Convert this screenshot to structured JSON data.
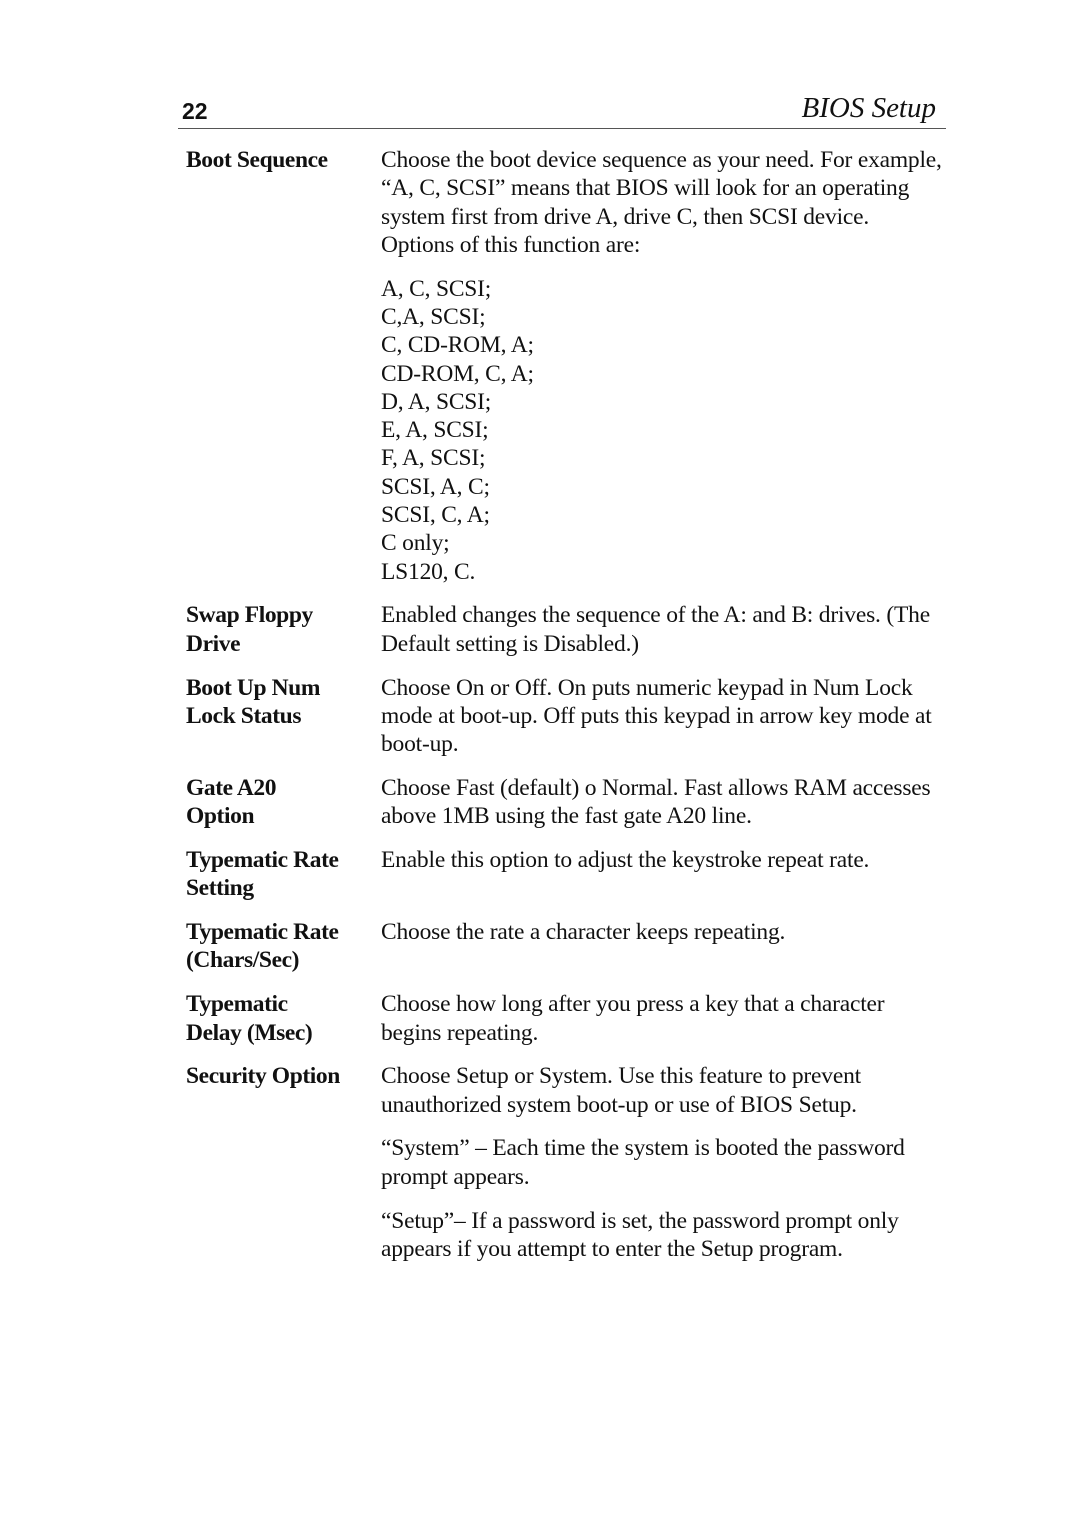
{
  "header": {
    "page_number": "22",
    "running_title": "BIOS Setup"
  },
  "entries": [
    {
      "term": [
        "Boot Sequence"
      ],
      "paragraphs": [
        "Choose the boot device sequence as your need.  For example, “A, C, SCSI” means that BIOS will look for an operating system first from drive A, drive C, then SCSI device.  Options of this function are:"
      ],
      "options": [
        "A, C, SCSI;",
        "C,A, SCSI;",
        "C, CD-ROM, A;",
        "CD-ROM, C, A;",
        "D, A, SCSI;",
        "E, A, SCSI;",
        "F, A, SCSI;",
        "SCSI, A, C;",
        "SCSI, C, A;",
        "C only;",
        "LS120, C."
      ]
    },
    {
      "term": [
        "Swap Floppy",
        "Drive"
      ],
      "paragraphs": [
        "Enabled changes the sequence of the A: and B: drives. (The Default setting is Disabled.)"
      ]
    },
    {
      "term": [
        "Boot Up Num",
        "Lock Status"
      ],
      "paragraphs": [
        "Choose On or Off. On puts numeric keypad in Num Lock mode at boot-up. Off puts this keypad in arrow key mode at boot-up."
      ]
    },
    {
      "term": [
        "Gate A20",
        "Option"
      ],
      "paragraphs": [
        "Choose Fast (default) o Normal. Fast allows RAM accesses above 1MB using the fast gate A20 line."
      ]
    },
    {
      "term": [
        "Typematic Rate",
        "Setting"
      ],
      "paragraphs": [
        "Enable this option to adjust the keystroke repeat rate."
      ]
    },
    {
      "term": [
        "Typematic Rate",
        "(Chars/Sec)"
      ],
      "paragraphs": [
        "Choose the rate a character keeps repeating."
      ]
    },
    {
      "term": [
        "Typematic",
        "Delay (Msec)"
      ],
      "paragraphs": [
        "Choose how long after you press a key that a character begins repeating."
      ]
    },
    {
      "term": [
        "Security Option"
      ],
      "paragraphs": [
        "Choose Setup or System. Use this feature to prevent unauthorized system boot-up or use of BIOS Setup.",
        "“System” –  Each time the system is booted the password prompt appears.",
        "“Setup”–  If a password is set, the password prompt only appears if you attempt to enter the Setup program."
      ]
    }
  ]
}
